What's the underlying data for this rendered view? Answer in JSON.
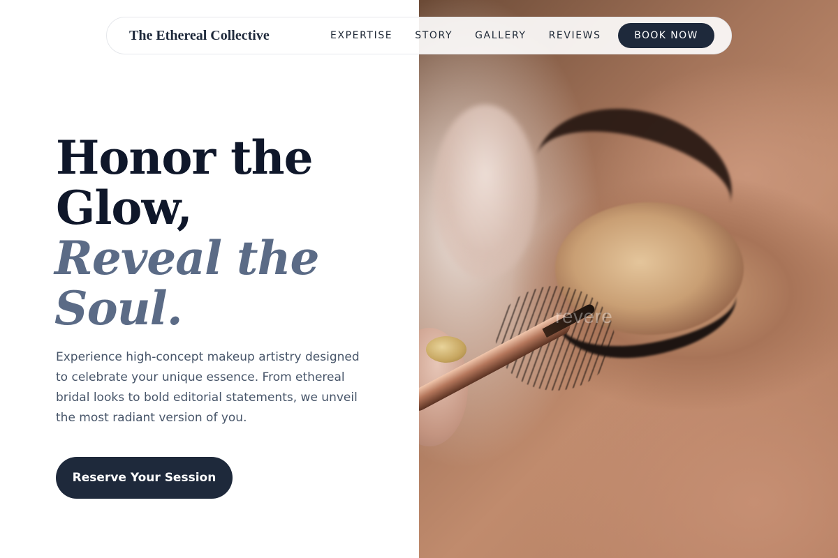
{
  "nav": {
    "brand": "The Ethereal Collective",
    "links": [
      "EXPERTISE",
      "STORY",
      "GALLERY",
      "REVIEWS"
    ],
    "book_label": "BOOK NOW"
  },
  "hero": {
    "headline_line1": "Honor the",
    "headline_line2": "Glow,",
    "accent_line1": "Reveal the",
    "accent_line2": "Soul.",
    "description": "Experience high-concept makeup artistry designed to celebrate your unique essence. From ethereal bridal looks to bold editorial statements, we unveil the most radiant version of you.",
    "cta_label": "Reserve Your Session"
  },
  "image": {
    "watermark": "revere"
  },
  "colors": {
    "primary": "#1e293b",
    "accent_text": "#5b6b86",
    "body_text": "#475569",
    "background": "#ffffff"
  }
}
